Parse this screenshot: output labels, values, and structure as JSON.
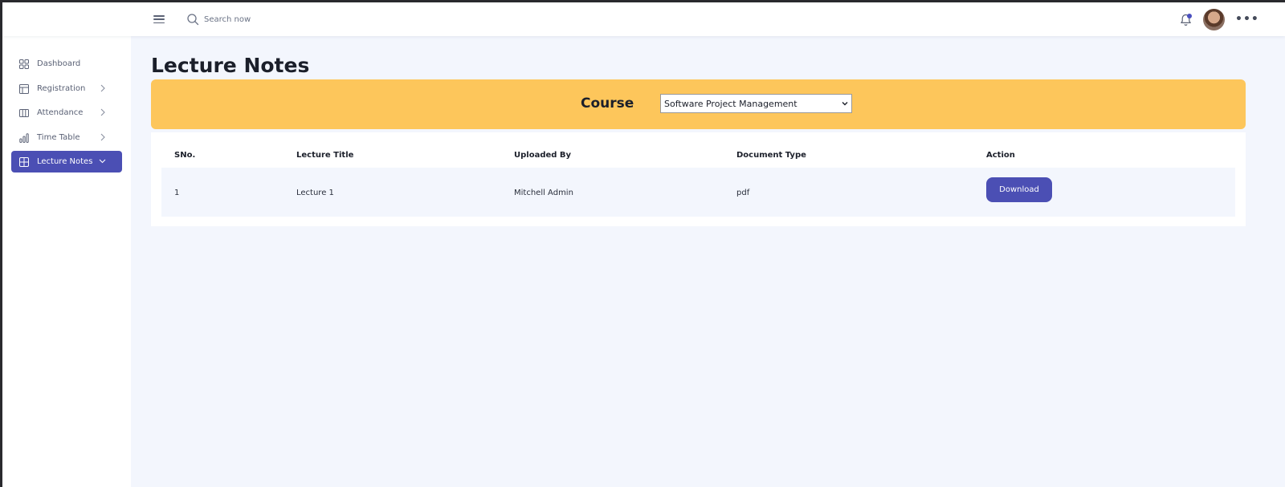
{
  "header": {
    "search": {
      "placeholder": "Search now"
    },
    "icons": [
      "menu-icon",
      "search-icon",
      "bell-icon",
      "avatar",
      "more-icon"
    ]
  },
  "sidebar": {
    "items": [
      {
        "label": "Dashboard",
        "icon": "dashboard-icon",
        "has_chevron": false,
        "active": false
      },
      {
        "label": "Registration",
        "icon": "registration-icon",
        "has_chevron": true,
        "active": false
      },
      {
        "label": "Attendance",
        "icon": "attendance-icon",
        "has_chevron": true,
        "active": false
      },
      {
        "label": "Time Table",
        "icon": "chart-icon",
        "has_chevron": true,
        "active": false
      },
      {
        "label": "Lecture Notes",
        "icon": "grid-icon",
        "has_chevron": true,
        "active": true
      }
    ]
  },
  "main": {
    "title": "Lecture Notes",
    "course": {
      "label": "Course",
      "selected": "Software Project Management"
    },
    "table": {
      "columns": [
        "SNo.",
        "Lecture Title",
        "Uploaded By",
        "Document Type",
        "Action"
      ],
      "rows": [
        {
          "sno": "1",
          "title": "Lecture 1",
          "uploaded_by": "Mitchell Admin",
          "doc_type": "pdf",
          "action": "Download"
        }
      ]
    }
  },
  "colors": {
    "accent": "#4b4fb4",
    "course_bar": "#fdc65b",
    "background": "#f3f6fd"
  }
}
